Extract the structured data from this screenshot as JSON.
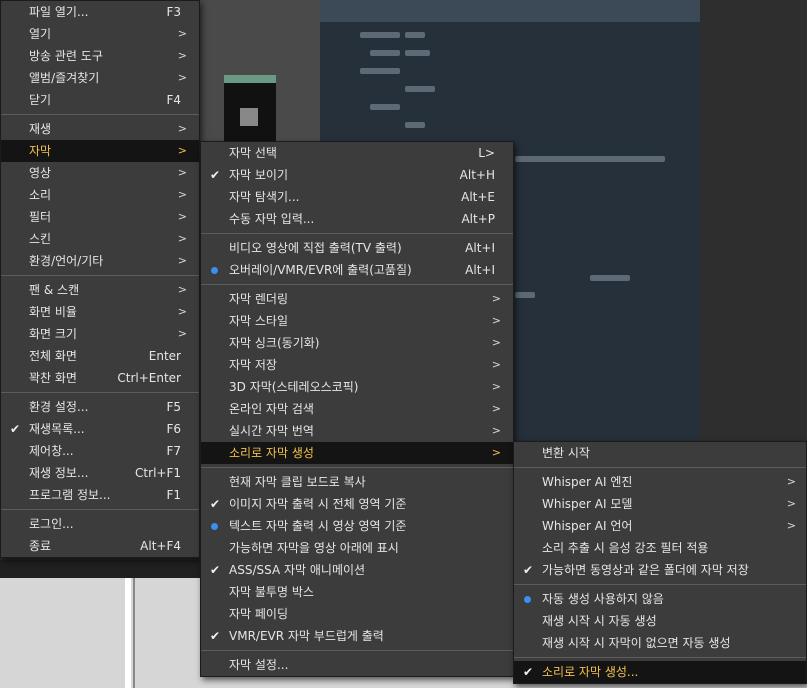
{
  "main_menu": [
    {
      "label": "파일 열기...",
      "shortcut": "F3"
    },
    {
      "label": "열기",
      "arrow": ">"
    },
    {
      "label": "방송 관련 도구",
      "arrow": ">"
    },
    {
      "label": "앨범/즐겨찾기",
      "arrow": ">"
    },
    {
      "label": "닫기",
      "shortcut": "F4"
    },
    {
      "sep": true
    },
    {
      "label": "재생",
      "arrow": ">"
    },
    {
      "label": "자막",
      "arrow": ">",
      "active": true
    },
    {
      "label": "영상",
      "arrow": ">"
    },
    {
      "label": "소리",
      "arrow": ">"
    },
    {
      "label": "필터",
      "arrow": ">"
    },
    {
      "label": "스킨",
      "arrow": ">"
    },
    {
      "label": "환경/언어/기타",
      "arrow": ">"
    },
    {
      "sep": true
    },
    {
      "label": "팬 & 스캔",
      "arrow": ">"
    },
    {
      "label": "화면 비율",
      "arrow": ">"
    },
    {
      "label": "화면 크기",
      "arrow": ">"
    },
    {
      "label": "전체 화면",
      "shortcut": "Enter"
    },
    {
      "label": "꽉찬 화면",
      "shortcut": "Ctrl+Enter"
    },
    {
      "sep": true
    },
    {
      "label": "환경 설정...",
      "shortcut": "F5"
    },
    {
      "label": "재생목록...",
      "shortcut": "F6",
      "checked": true
    },
    {
      "label": "제어창...",
      "shortcut": "F7"
    },
    {
      "label": "재생 정보...",
      "shortcut": "Ctrl+F1"
    },
    {
      "label": "프로그램 정보...",
      "shortcut": "F1"
    },
    {
      "sep": true
    },
    {
      "label": "로그인..."
    },
    {
      "label": "종료",
      "shortcut": "Alt+F4"
    }
  ],
  "subtitle_menu": [
    {
      "label": "자막 선택",
      "shortcut": "L>"
    },
    {
      "label": "자막 보이기",
      "shortcut": "Alt+H",
      "checked": true
    },
    {
      "label": "자막 탐색기...",
      "shortcut": "Alt+E"
    },
    {
      "label": "수동 자막 입력...",
      "shortcut": "Alt+P"
    },
    {
      "sep": true
    },
    {
      "label": "비디오 영상에 직접 출력(TV 출력)",
      "shortcut": "Alt+I"
    },
    {
      "label": "오버레이/VMR/EVR에 출력(고품질)",
      "shortcut": "Alt+I",
      "radio": true
    },
    {
      "sep": true
    },
    {
      "label": "자막 렌더링",
      "arrow": ">"
    },
    {
      "label": "자막 스타일",
      "arrow": ">"
    },
    {
      "label": "자막 싱크(동기화)",
      "arrow": ">"
    },
    {
      "label": "자막 저장",
      "arrow": ">"
    },
    {
      "label": "3D 자막(스테레오스코픽)",
      "arrow": ">"
    },
    {
      "label": "온라인 자막 검색",
      "arrow": ">"
    },
    {
      "label": "실시간 자막 번역",
      "arrow": ">"
    },
    {
      "label": "소리로 자막 생성",
      "arrow": ">",
      "active": true
    },
    {
      "sep": true
    },
    {
      "label": "현재 자막 클립 보드로 복사"
    },
    {
      "label": "이미지 자막 출력 시 전체 영역 기준",
      "checked": true
    },
    {
      "label": "텍스트 자막 출력 시 영상 영역 기준",
      "radio": true
    },
    {
      "label": "가능하면 자막을 영상 아래에 표시"
    },
    {
      "label": "ASS/SSA 자막 애니메이션",
      "checked": true
    },
    {
      "label": "자막 불투명 박스"
    },
    {
      "label": "자막 페이딩"
    },
    {
      "label": "VMR/EVR 자막 부드럽게 출력",
      "checked": true
    },
    {
      "sep": true
    },
    {
      "label": "자막 설정..."
    }
  ],
  "speech_menu": [
    {
      "label": "변환 시작"
    },
    {
      "sep": true
    },
    {
      "label": "Whisper AI 엔진",
      "arrow": ">"
    },
    {
      "label": "Whisper AI 모델",
      "arrow": ">"
    },
    {
      "label": "Whisper AI 언어",
      "arrow": ">"
    },
    {
      "label": "소리 추출 시 음성 강조 필터 적용"
    },
    {
      "label": "가능하면 동영상과 같은 폴더에 자막 저장",
      "checked": true
    },
    {
      "sep": true
    },
    {
      "label": "자동 생성 사용하지 않음",
      "radio": true
    },
    {
      "label": "재생 시작 시 자동 생성"
    },
    {
      "label": "재생 시작 시 자막이 없으면 자동 생성"
    },
    {
      "sep": true
    },
    {
      "label": "소리로 자막 생성...",
      "checked": true,
      "active": true
    }
  ],
  "glyphs": {
    "check": "✔"
  },
  "colors": {
    "accent": "#f3c24a",
    "radio": "#3b8ff0",
    "menu_bg": "#3c3c3c",
    "active_bg": "#141414"
  }
}
